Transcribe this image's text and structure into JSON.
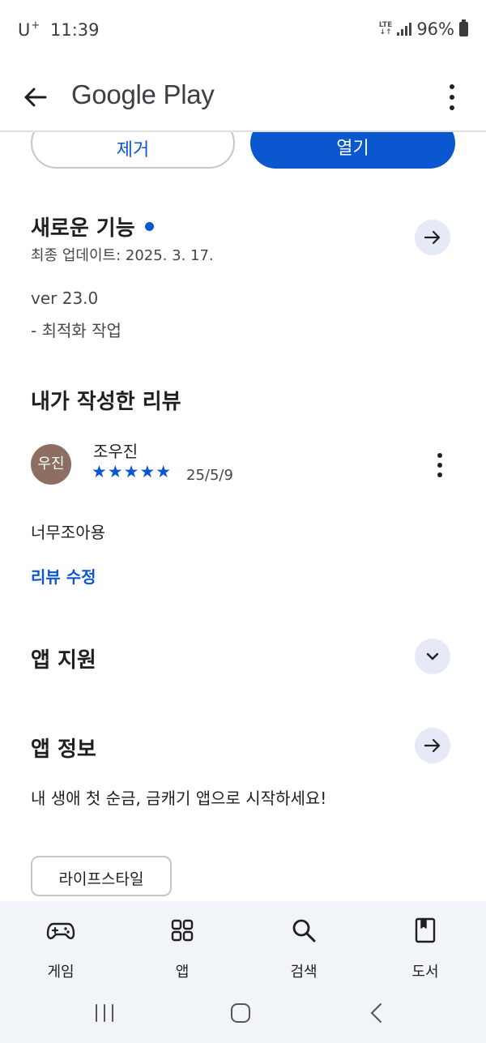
{
  "status_bar": {
    "carrier": "U",
    "carrier_sup": "+",
    "time": "11:39",
    "network_top": "LTE",
    "network_bottom": "↓↑",
    "battery": "96%"
  },
  "app_bar": {
    "title": "Google Play",
    "back_icon": "arrow-back-icon",
    "more_icon": "more-vert-icon"
  },
  "actions": {
    "remove_label": "제거",
    "open_label": "열기"
  },
  "whats_new": {
    "title": "새로운 기능",
    "updated": "최종 업데이트: 2025. 3. 17.",
    "version": "ver 23.0",
    "note": "- 최적화 작업"
  },
  "my_review": {
    "title": "내가 작성한 리뷰",
    "avatar_text": "우진",
    "reviewer": "조우진",
    "stars": "★★★★★",
    "rating": 5,
    "date": "25/5/9",
    "text": "너무조아용",
    "edit_label": "리뷰 수정"
  },
  "app_support": {
    "title": "앱 지원"
  },
  "app_info": {
    "title": "앱 정보",
    "description": "내 생애 첫 순금, 금캐기 앱으로 시작하세요!",
    "category": "라이프스타일"
  },
  "bottom_nav": {
    "items": [
      {
        "label": "게임",
        "icon": "gamepad-icon"
      },
      {
        "label": "앱",
        "icon": "apps-grid-icon"
      },
      {
        "label": "검색",
        "icon": "search-icon"
      },
      {
        "label": "도서",
        "icon": "book-icon"
      }
    ]
  },
  "colors": {
    "accent": "#0b57d0",
    "avatar": "#8d6e63",
    "nav_background": "#f1f4f9"
  }
}
